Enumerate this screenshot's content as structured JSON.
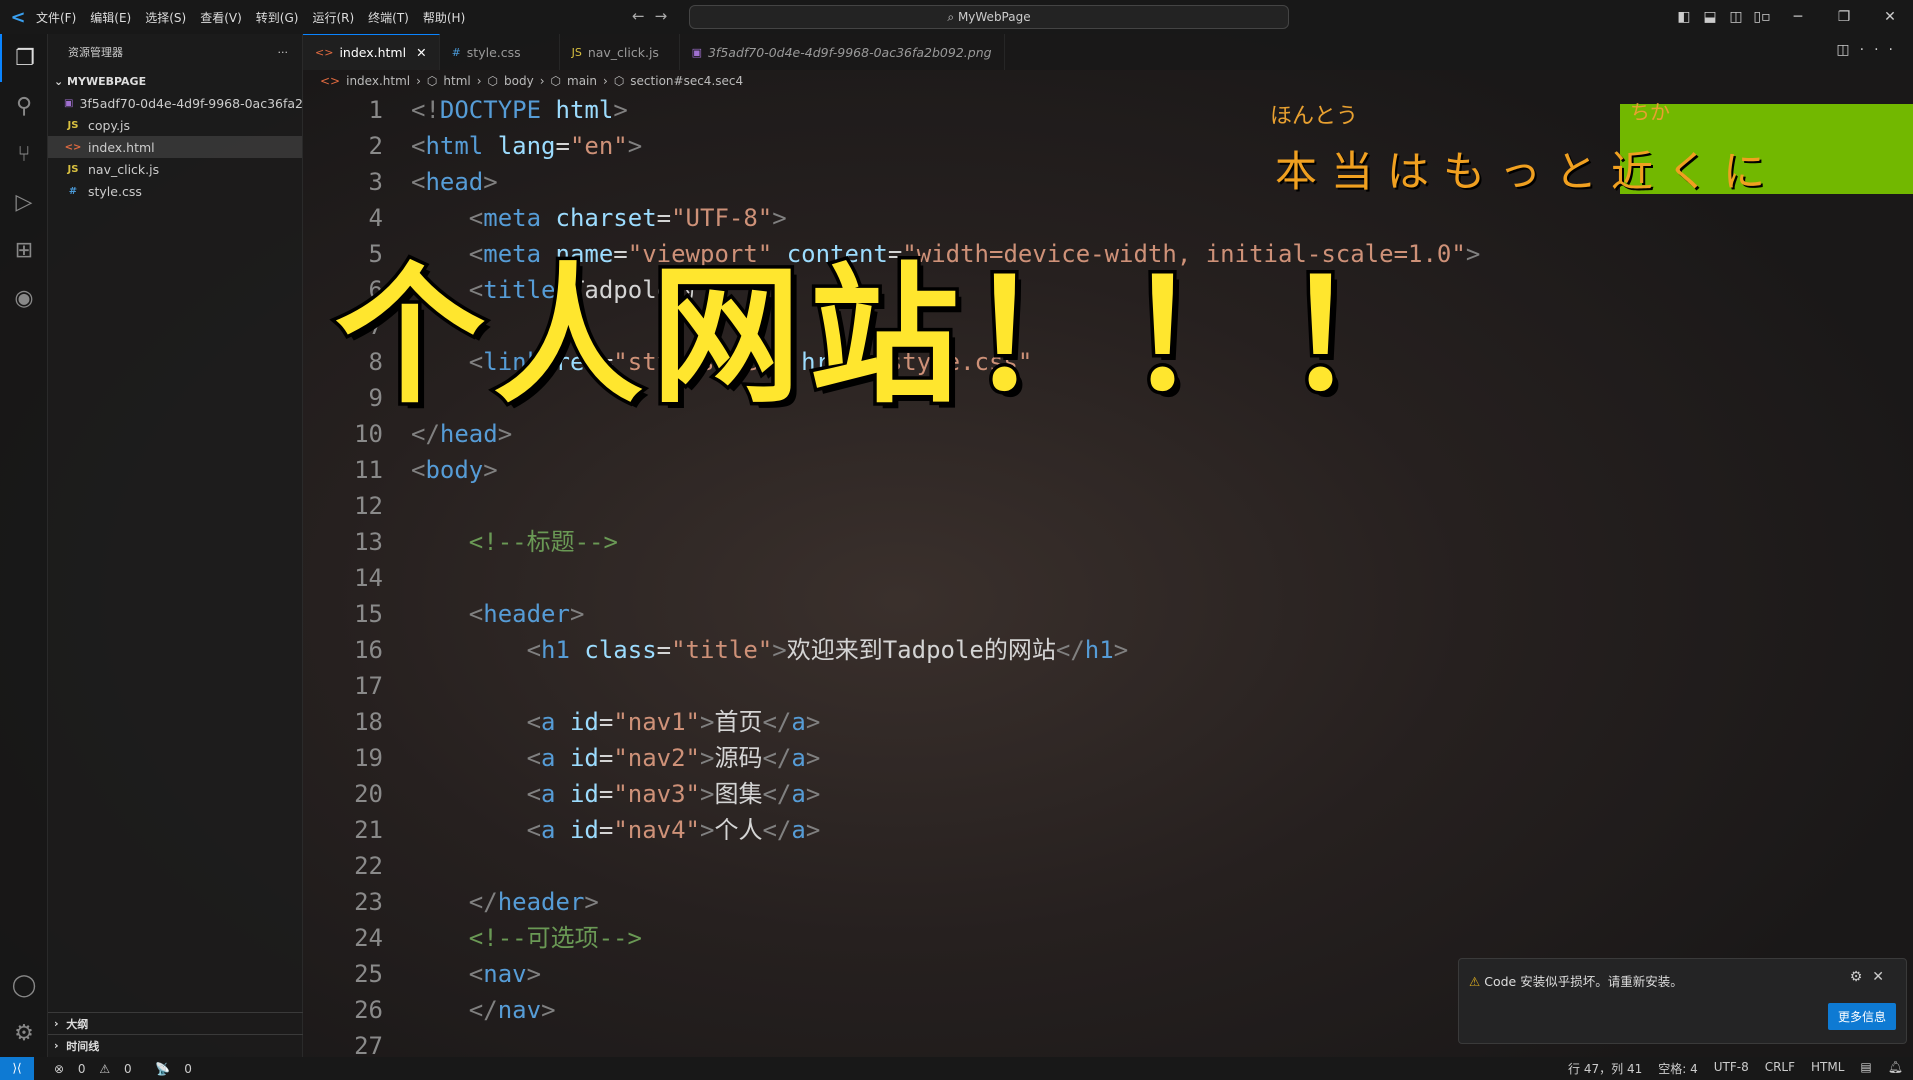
{
  "titlebar": {
    "menus": [
      "文件(F)",
      "编辑(E)",
      "选择(S)",
      "查看(V)",
      "转到(G)",
      "运行(R)",
      "终端(T)",
      "帮助(H)"
    ],
    "search": "MyWebPage"
  },
  "sidebar": {
    "title": "资源管理器",
    "folder": "MYWEBPAGE",
    "files": [
      {
        "name": "3f5adf70-0d4e-4d9f-9968-0ac36fa2...",
        "icon": "image-icon"
      },
      {
        "name": "copy.js",
        "icon": "js-icon"
      },
      {
        "name": "index.html",
        "icon": "html-icon",
        "selected": true
      },
      {
        "name": "nav_click.js",
        "icon": "js-icon"
      },
      {
        "name": "style.css",
        "icon": "css-icon"
      }
    ],
    "outline": "大纲",
    "timeline": "时间线"
  },
  "tabs": [
    {
      "label": "index.html",
      "icon": "html-icon",
      "active": true
    },
    {
      "label": "style.css",
      "icon": "css-icon"
    },
    {
      "label": "nav_click.js",
      "icon": "js-icon"
    },
    {
      "label": "3f5adf70-0d4e-4d9f-9968-0ac36fa2b092.png",
      "icon": "image-icon"
    }
  ],
  "breadcrumb": [
    "index.html",
    "html",
    "body",
    "main",
    "section#sec4.sec4"
  ],
  "code": [
    [
      [
        "t-p",
        "<!"
      ],
      [
        "t-tag",
        "DOCTYPE"
      ],
      [
        "t-attr",
        " html"
      ],
      [
        "t-p",
        ">"
      ]
    ],
    [
      [
        "t-p",
        "<"
      ],
      [
        "t-tag",
        "html"
      ],
      [
        "t-attr",
        " lang"
      ],
      [
        "t-txt",
        "="
      ],
      [
        "t-str",
        "\"en\""
      ],
      [
        "t-p",
        ">"
      ]
    ],
    [
      [
        "t-p",
        "<"
      ],
      [
        "t-tag",
        "head"
      ],
      [
        "t-p",
        ">"
      ]
    ],
    [
      [
        "t-txt",
        "    "
      ],
      [
        "t-p",
        "<"
      ],
      [
        "t-tag",
        "meta"
      ],
      [
        "t-attr",
        " charset"
      ],
      [
        "t-txt",
        "="
      ],
      [
        "t-str",
        "\"UTF-8\""
      ],
      [
        "t-p",
        ">"
      ]
    ],
    [
      [
        "t-txt",
        "    "
      ],
      [
        "t-p",
        "<"
      ],
      [
        "t-tag",
        "meta"
      ],
      [
        "t-attr",
        " name"
      ],
      [
        "t-txt",
        "="
      ],
      [
        "t-str",
        "\"viewport\""
      ],
      [
        "t-attr",
        " content"
      ],
      [
        "t-txt",
        "="
      ],
      [
        "t-str",
        "\"width=device-width, initial-scale=1.0\""
      ],
      [
        "t-p",
        ">"
      ]
    ],
    [
      [
        "t-txt",
        "    "
      ],
      [
        "t-p",
        "<"
      ],
      [
        "t-tag",
        "title"
      ],
      [
        "t-p",
        ">"
      ],
      [
        "t-txt",
        "Tadpole的"
      ]
    ],
    [],
    [
      [
        "t-txt",
        "    "
      ],
      [
        "t-p",
        "<"
      ],
      [
        "t-tag",
        "link"
      ],
      [
        "t-attr",
        " rel"
      ],
      [
        "t-txt",
        "="
      ],
      [
        "t-str",
        "\"stylesheet\""
      ],
      [
        "t-attr",
        " href"
      ],
      [
        "t-txt",
        "="
      ],
      [
        "t-str",
        "\"style.css\""
      ]
    ],
    [],
    [
      [
        "t-p",
        "</"
      ],
      [
        "t-tag",
        "head"
      ],
      [
        "t-p",
        ">"
      ]
    ],
    [
      [
        "t-p",
        "<"
      ],
      [
        "t-tag",
        "body"
      ],
      [
        "t-p",
        ">"
      ]
    ],
    [],
    [
      [
        "t-txt",
        "    "
      ],
      [
        "t-com",
        "<!--标题-->"
      ]
    ],
    [],
    [
      [
        "t-txt",
        "    "
      ],
      [
        "t-p",
        "<"
      ],
      [
        "t-tag",
        "header"
      ],
      [
        "t-p",
        ">"
      ]
    ],
    [
      [
        "t-txt",
        "        "
      ],
      [
        "t-p",
        "<"
      ],
      [
        "t-tag",
        "h1"
      ],
      [
        "t-attr",
        " class"
      ],
      [
        "t-txt",
        "="
      ],
      [
        "t-str",
        "\"title\""
      ],
      [
        "t-p",
        ">"
      ],
      [
        "t-txt",
        "欢迎来到Tadpole的网站"
      ],
      [
        "t-p",
        "</"
      ],
      [
        "t-tag",
        "h1"
      ],
      [
        "t-p",
        ">"
      ]
    ],
    [],
    [
      [
        "t-txt",
        "        "
      ],
      [
        "t-p",
        "<"
      ],
      [
        "t-tag",
        "a"
      ],
      [
        "t-attr",
        " id"
      ],
      [
        "t-txt",
        "="
      ],
      [
        "t-str",
        "\"nav1\""
      ],
      [
        "t-p",
        ">"
      ],
      [
        "t-txt",
        "首页"
      ],
      [
        "t-p",
        "</"
      ],
      [
        "t-tag",
        "a"
      ],
      [
        "t-p",
        ">"
      ]
    ],
    [
      [
        "t-txt",
        "        "
      ],
      [
        "t-p",
        "<"
      ],
      [
        "t-tag",
        "a"
      ],
      [
        "t-attr",
        " id"
      ],
      [
        "t-txt",
        "="
      ],
      [
        "t-str",
        "\"nav2\""
      ],
      [
        "t-p",
        ">"
      ],
      [
        "t-txt",
        "源码"
      ],
      [
        "t-p",
        "</"
      ],
      [
        "t-tag",
        "a"
      ],
      [
        "t-p",
        ">"
      ]
    ],
    [
      [
        "t-txt",
        "        "
      ],
      [
        "t-p",
        "<"
      ],
      [
        "t-tag",
        "a"
      ],
      [
        "t-attr",
        " id"
      ],
      [
        "t-txt",
        "="
      ],
      [
        "t-str",
        "\"nav3\""
      ],
      [
        "t-p",
        ">"
      ],
      [
        "t-txt",
        "图集"
      ],
      [
        "t-p",
        "</"
      ],
      [
        "t-tag",
        "a"
      ],
      [
        "t-p",
        ">"
      ]
    ],
    [
      [
        "t-txt",
        "        "
      ],
      [
        "t-p",
        "<"
      ],
      [
        "t-tag",
        "a"
      ],
      [
        "t-attr",
        " id"
      ],
      [
        "t-txt",
        "="
      ],
      [
        "t-str",
        "\"nav4\""
      ],
      [
        "t-p",
        ">"
      ],
      [
        "t-txt",
        "个人"
      ],
      [
        "t-p",
        "</"
      ],
      [
        "t-tag",
        "a"
      ],
      [
        "t-p",
        ">"
      ]
    ],
    [],
    [
      [
        "t-txt",
        "    "
      ],
      [
        "t-p",
        "</"
      ],
      [
        "t-tag",
        "header"
      ],
      [
        "t-p",
        ">"
      ]
    ],
    [
      [
        "t-txt",
        "    "
      ],
      [
        "t-com",
        "<!--可选项-->"
      ]
    ],
    [
      [
        "t-txt",
        "    "
      ],
      [
        "t-p",
        "<"
      ],
      [
        "t-tag",
        "nav"
      ],
      [
        "t-p",
        ">"
      ]
    ],
    [
      [
        "t-txt",
        "    "
      ],
      [
        "t-p",
        "</"
      ],
      [
        "t-tag",
        "nav"
      ],
      [
        "t-p",
        ">"
      ]
    ],
    []
  ],
  "overlay": {
    "caption": "个人网站！！！",
    "jp_ruby_1": "ほんとう",
    "jp_ruby_2": "ちか",
    "jp_text": "本当はもっと近くに",
    "jp_highlight": "#72b800"
  },
  "notification": {
    "message": "Code 安装似乎损坏。请重新安装。",
    "button": "更多信息"
  },
  "status": {
    "errors": "0",
    "warnings": "0",
    "ports": "0",
    "position": "行 47，列 41",
    "spaces": "空格: 4",
    "encoding": "UTF-8",
    "eol": "CRLF",
    "language": "HTML"
  }
}
